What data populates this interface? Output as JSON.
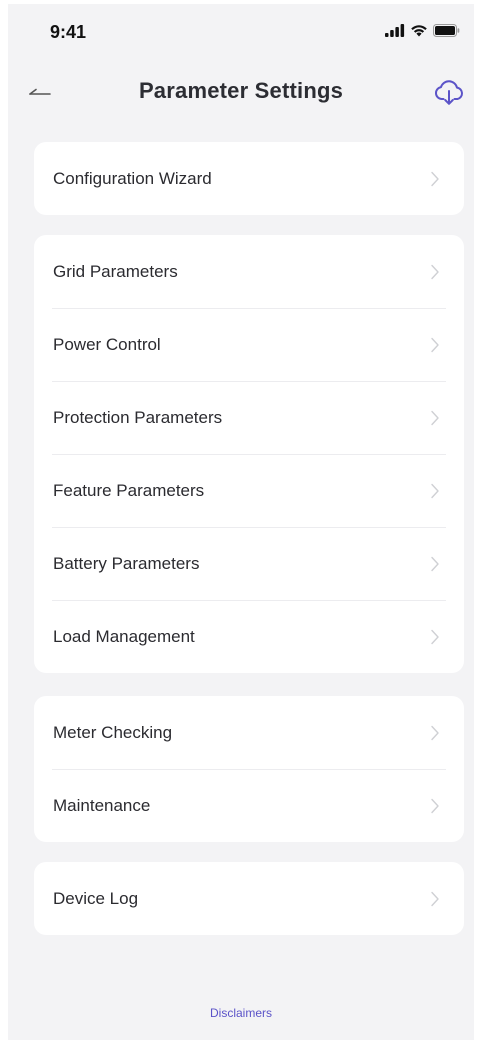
{
  "status_bar": {
    "time": "9:41",
    "icons": [
      "signal-icon",
      "wifi-icon",
      "battery-icon"
    ]
  },
  "header": {
    "title": "Parameter Settings",
    "back_icon": "back-arrow-icon",
    "action_icon": "cloud-download-icon",
    "accent_color": "#5b53c8"
  },
  "groups": [
    {
      "items": [
        {
          "label": "Configuration Wizard"
        }
      ]
    },
    {
      "items": [
        {
          "label": "Grid Parameters"
        },
        {
          "label": "Power Control"
        },
        {
          "label": "Protection Parameters"
        },
        {
          "label": "Feature Parameters"
        },
        {
          "label": "Battery Parameters"
        },
        {
          "label": "Load Management"
        }
      ]
    },
    {
      "items": [
        {
          "label": "Meter Checking"
        },
        {
          "label": "Maintenance"
        }
      ]
    },
    {
      "items": [
        {
          "label": "Device Log"
        }
      ]
    }
  ],
  "footer": {
    "link_label": "Disclaimers"
  }
}
